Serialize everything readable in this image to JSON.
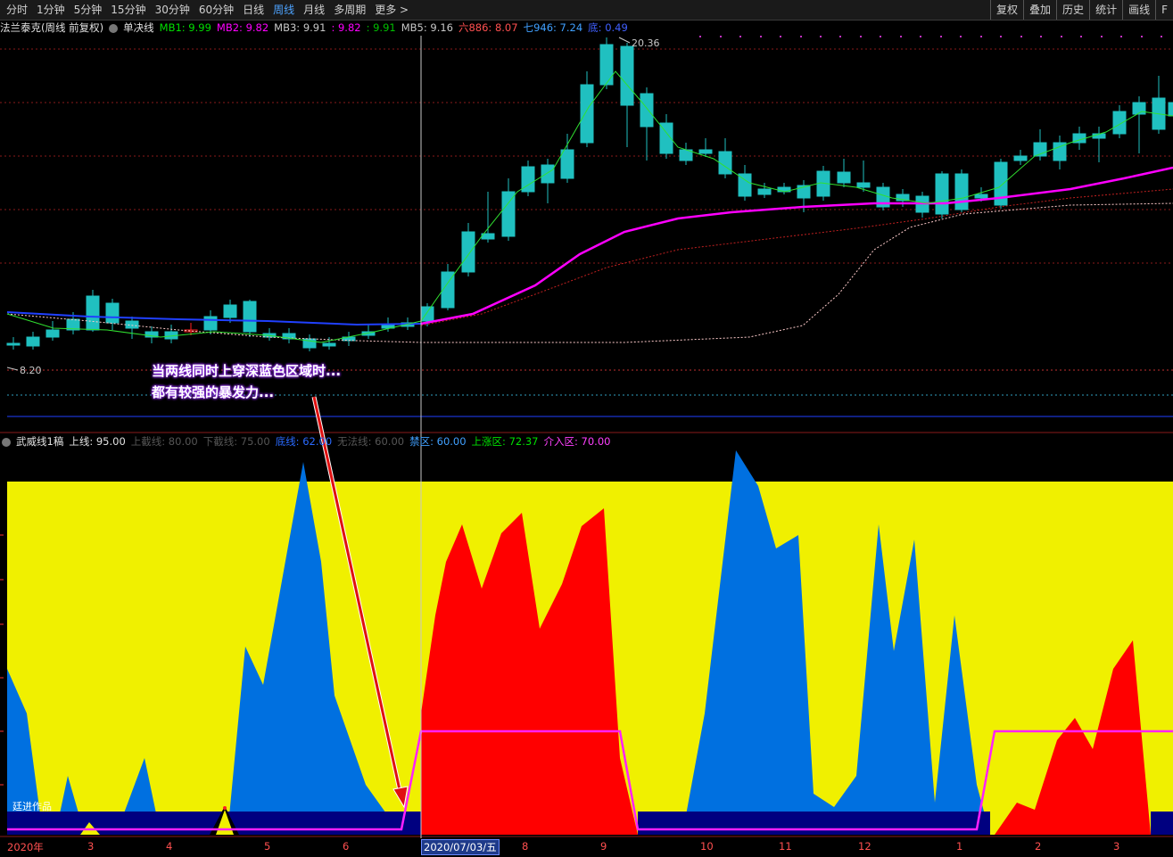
{
  "toolbar": {
    "periods": [
      "分时",
      "1分钟",
      "5分钟",
      "15分钟",
      "30分钟",
      "60分钟",
      "日线",
      "周线",
      "月线",
      "多周期",
      "更多 >"
    ],
    "active_index": 7,
    "right_buttons": [
      "复权",
      "叠加",
      "历史",
      "统计",
      "画线",
      "F"
    ]
  },
  "main_panel": {
    "stock_label": "法兰泰克(周线 前复权)",
    "indicator_name": "单决线",
    "ma_items": [
      {
        "label": "MB1: 9.99",
        "color": "#00e000"
      },
      {
        "label": "MB2: 9.82",
        "color": "#ff00ff"
      },
      {
        "label": "MB3: 9.91",
        "color": "#c8c8c8"
      },
      {
        "label": ": 9.82",
        "color": "#ff00ff"
      },
      {
        "label": ": 9.91",
        "color": "#00c000"
      },
      {
        "label": "MB5: 9.16",
        "color": "#c8c8c8"
      },
      {
        "label": "六886: 8.07",
        "color": "#ff5050"
      },
      {
        "label": "七946: 7.24",
        "color": "#40a0ff"
      },
      {
        "label": "底: 0.49",
        "color": "#4060ff"
      }
    ],
    "high_label": "20.36",
    "low_label": "8.20"
  },
  "callout": {
    "line1": "当两线同时上穿深蓝色区域时...",
    "line2": "都有较强的暴发力..."
  },
  "sub_panel": {
    "name": "武威线1稿",
    "items": [
      {
        "label": "上线: 95.00",
        "color": "#e0e0e0"
      },
      {
        "label": "上截线: 80.00",
        "color": "#555555"
      },
      {
        "label": "下截线: 75.00",
        "color": "#555555"
      },
      {
        "label": "底线: 62.00",
        "color": "#2a6aff"
      },
      {
        "label": "无法线: 60.00",
        "color": "#555555"
      },
      {
        "label": "禁区: 60.00",
        "color": "#40a0ff"
      },
      {
        "label": "上涨区: 72.37",
        "color": "#00e000"
      },
      {
        "label": "介入区: 70.00",
        "color": "#ff40ff"
      }
    ],
    "bottom_label": "廷进作品"
  },
  "date_axis": {
    "ticks": [
      "2020年",
      "3",
      "4",
      "5",
      "6",
      "8",
      "9",
      "10",
      "11",
      "12",
      "1",
      "2",
      "3"
    ],
    "current_date": "2020/07/03/五"
  },
  "colors": {
    "up": "#ff2020",
    "down": "#20c0c0",
    "ma_pink": "#ff00ff",
    "ma_blue": "#2040ff",
    "fill_yellow": "#f0f000",
    "fill_blue": "#0070e0",
    "fill_red": "#ff0000",
    "fill_navy": "#000080"
  }
}
